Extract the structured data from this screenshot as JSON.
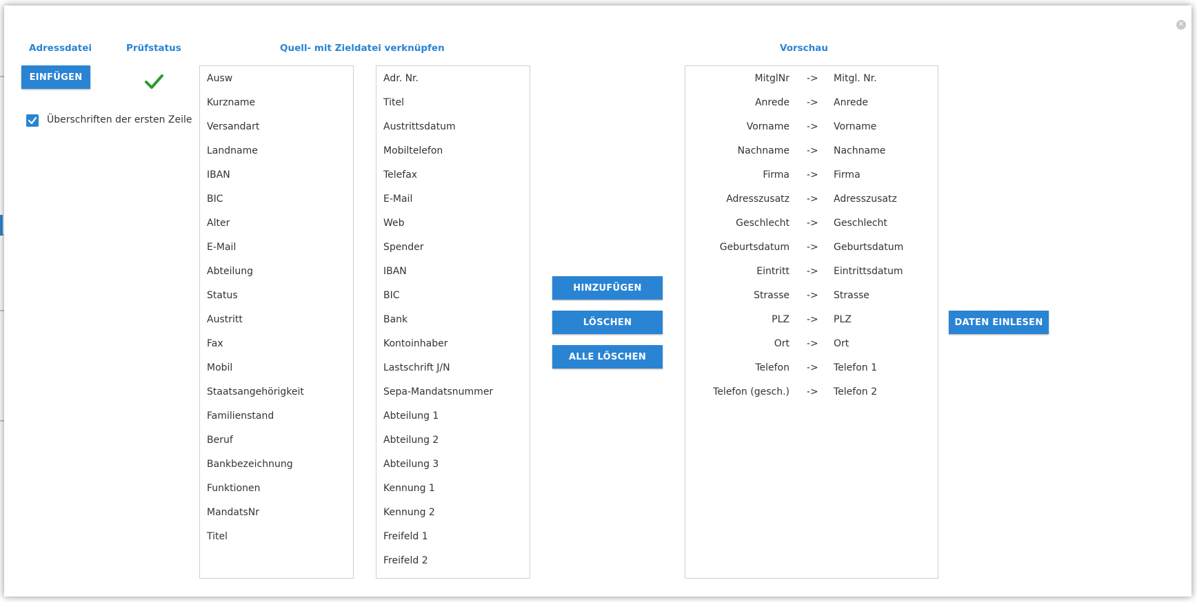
{
  "dialog": {
    "close_symbol": "✕"
  },
  "headings": {
    "adressdatei": "Adressdatei",
    "pruefstatus": "Prüfstatus",
    "link": "Quell- mit Zieldatei verknüpfen",
    "vorschau": "Vorschau"
  },
  "buttons": {
    "einfuegen": "EINFÜGEN",
    "hinzufuegen": "HINZUFÜGEN",
    "loeschen": "LÖSCHEN",
    "alle_loeschen": "ALLE LÖSCHEN",
    "daten_einlesen": "DATEN EINLESEN"
  },
  "pruefstatus_icon": "check-icon",
  "checkbox": {
    "label": "Überschriften der ersten Zeile",
    "checked": true
  },
  "source_list": [
    "Ausw",
    "Kurzname",
    "Versandart",
    "Landname",
    "IBAN",
    "BIC",
    "Alter",
    "E-Mail",
    "Abteilung",
    "Status",
    "Austritt",
    "Fax",
    "Mobil",
    "Staatsangehörigkeit",
    "Familienstand",
    "Beruf",
    "Bankbezeichnung",
    "Funktionen",
    "MandatsNr",
    "Titel"
  ],
  "target_list": [
    "Adr. Nr.",
    "Titel",
    "Austrittsdatum",
    "Mobiltelefon",
    "Telefax",
    "E-Mail",
    "Web",
    "Spender",
    "IBAN",
    "BIC",
    "Bank",
    "Kontoinhaber",
    "Lastschrift J/N",
    "Sepa-Mandatsnummer",
    "Abteilung 1",
    "Abteilung 2",
    "Abteilung 3",
    "Kennung 1",
    "Kennung 2",
    "Freifeld 1",
    "Freifeld 2"
  ],
  "preview": {
    "arrow": "->",
    "rows": [
      {
        "src": "MitglNr",
        "dst": "Mitgl. Nr."
      },
      {
        "src": "Anrede",
        "dst": "Anrede"
      },
      {
        "src": "Vorname",
        "dst": "Vorname"
      },
      {
        "src": "Nachname",
        "dst": "Nachname"
      },
      {
        "src": "Firma",
        "dst": "Firma"
      },
      {
        "src": "Adresszusatz",
        "dst": "Adresszusatz"
      },
      {
        "src": "Geschlecht",
        "dst": "Geschlecht"
      },
      {
        "src": "Geburtsdatum",
        "dst": "Geburtsdatum"
      },
      {
        "src": "Eintritt",
        "dst": "Eintrittsdatum"
      },
      {
        "src": "Strasse",
        "dst": "Strasse"
      },
      {
        "src": "PLZ",
        "dst": "PLZ"
      },
      {
        "src": "Ort",
        "dst": "Ort"
      },
      {
        "src": "Telefon",
        "dst": "Telefon 1"
      },
      {
        "src": "Telefon (gesch.)",
        "dst": "Telefon 2"
      }
    ]
  },
  "colors": {
    "accent": "#2a84d4",
    "success": "#2e9a2e",
    "border": "#cfcfcf"
  }
}
